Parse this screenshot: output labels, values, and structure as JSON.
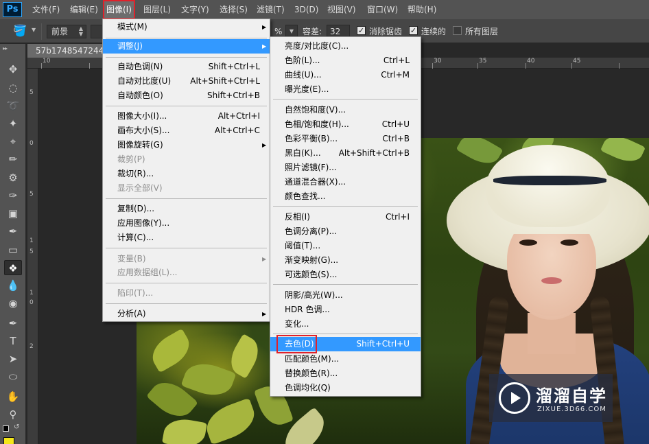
{
  "app": {
    "logo": "Ps"
  },
  "menubar": {
    "items": [
      {
        "label": "文件(F)"
      },
      {
        "label": "编辑(E)"
      },
      {
        "label": "图像(I)"
      },
      {
        "label": "图层(L)"
      },
      {
        "label": "文字(Y)"
      },
      {
        "label": "选择(S)"
      },
      {
        "label": "滤镜(T)"
      },
      {
        "label": "3D(D)"
      },
      {
        "label": "视图(V)"
      },
      {
        "label": "窗口(W)"
      },
      {
        "label": "帮助(H)"
      }
    ]
  },
  "options": {
    "fill_source": "前景",
    "opacity_suffix": "%",
    "tolerance_label": "容差:",
    "tolerance_value": "32",
    "antialias_label": "消除锯齿",
    "antialias_checked": true,
    "contiguous_label": "连续的",
    "contiguous_checked": true,
    "all_layers_label": "所有图层",
    "all_layers_checked": false
  },
  "document": {
    "tab_title": "57b1748547244.j",
    "ruler_h": [
      "10",
      "30",
      "35",
      "40",
      "45"
    ],
    "ruler_v": [
      "5",
      "0",
      "5",
      "1",
      "5",
      "1",
      "0",
      "2"
    ]
  },
  "image_menu": {
    "items": [
      {
        "label": "模式(M)",
        "shortcut": "",
        "submenu": true,
        "disabled": false
      },
      {
        "label": "调整(J)",
        "shortcut": "",
        "submenu": true,
        "disabled": false,
        "highlighted": true
      },
      {
        "label": "自动色调(N)",
        "shortcut": "Shift+Ctrl+L",
        "disabled": false
      },
      {
        "label": "自动对比度(U)",
        "shortcut": "Alt+Shift+Ctrl+L",
        "disabled": false
      },
      {
        "label": "自动颜色(O)",
        "shortcut": "Shift+Ctrl+B",
        "disabled": false
      },
      {
        "label": "图像大小(I)...",
        "shortcut": "Alt+Ctrl+I",
        "disabled": false
      },
      {
        "label": "画布大小(S)...",
        "shortcut": "Alt+Ctrl+C",
        "disabled": false
      },
      {
        "label": "图像旋转(G)",
        "shortcut": "",
        "submenu": true,
        "disabled": false
      },
      {
        "label": "裁剪(P)",
        "shortcut": "",
        "disabled": true
      },
      {
        "label": "裁切(R)...",
        "shortcut": "",
        "disabled": false
      },
      {
        "label": "显示全部(V)",
        "shortcut": "",
        "disabled": true
      },
      {
        "label": "复制(D)...",
        "shortcut": "",
        "disabled": false
      },
      {
        "label": "应用图像(Y)...",
        "shortcut": "",
        "disabled": false
      },
      {
        "label": "计算(C)...",
        "shortcut": "",
        "disabled": false
      },
      {
        "label": "变量(B)",
        "shortcut": "",
        "submenu": true,
        "disabled": true
      },
      {
        "label": "应用数据组(L)...",
        "shortcut": "",
        "disabled": true
      },
      {
        "label": "陷印(T)...",
        "shortcut": "",
        "disabled": true
      },
      {
        "label": "分析(A)",
        "shortcut": "",
        "submenu": true,
        "disabled": false
      }
    ]
  },
  "adjust_menu": {
    "items": [
      {
        "label": "亮度/对比度(C)...",
        "shortcut": ""
      },
      {
        "label": "色阶(L)...",
        "shortcut": "Ctrl+L"
      },
      {
        "label": "曲线(U)...",
        "shortcut": "Ctrl+M"
      },
      {
        "label": "曝光度(E)...",
        "shortcut": ""
      },
      {
        "label": "自然饱和度(V)...",
        "shortcut": ""
      },
      {
        "label": "色相/饱和度(H)...",
        "shortcut": "Ctrl+U"
      },
      {
        "label": "色彩平衡(B)...",
        "shortcut": "Ctrl+B"
      },
      {
        "label": "黑白(K)...",
        "shortcut": "Alt+Shift+Ctrl+B"
      },
      {
        "label": "照片滤镜(F)...",
        "shortcut": ""
      },
      {
        "label": "通道混合器(X)...",
        "shortcut": ""
      },
      {
        "label": "颜色查找...",
        "shortcut": ""
      },
      {
        "label": "反相(I)",
        "shortcut": "Ctrl+I"
      },
      {
        "label": "色调分离(P)...",
        "shortcut": ""
      },
      {
        "label": "阈值(T)...",
        "shortcut": ""
      },
      {
        "label": "渐变映射(G)...",
        "shortcut": ""
      },
      {
        "label": "可选颜色(S)...",
        "shortcut": ""
      },
      {
        "label": "阴影/高光(W)...",
        "shortcut": ""
      },
      {
        "label": "HDR 色调...",
        "shortcut": ""
      },
      {
        "label": "变化...",
        "shortcut": ""
      },
      {
        "label": "去色(D)",
        "shortcut": "Shift+Ctrl+U",
        "highlighted": true
      },
      {
        "label": "匹配颜色(M)...",
        "shortcut": ""
      },
      {
        "label": "替换颜色(R)...",
        "shortcut": ""
      },
      {
        "label": "色调均化(Q)",
        "shortcut": ""
      }
    ]
  },
  "watermark": {
    "brand": "溜溜自学",
    "url": "ZIXUE.3D66.COM"
  },
  "colors": {
    "highlight": "#3399ff",
    "annotation": "#e0212a",
    "foreground_swatch": "#f4e71a"
  }
}
